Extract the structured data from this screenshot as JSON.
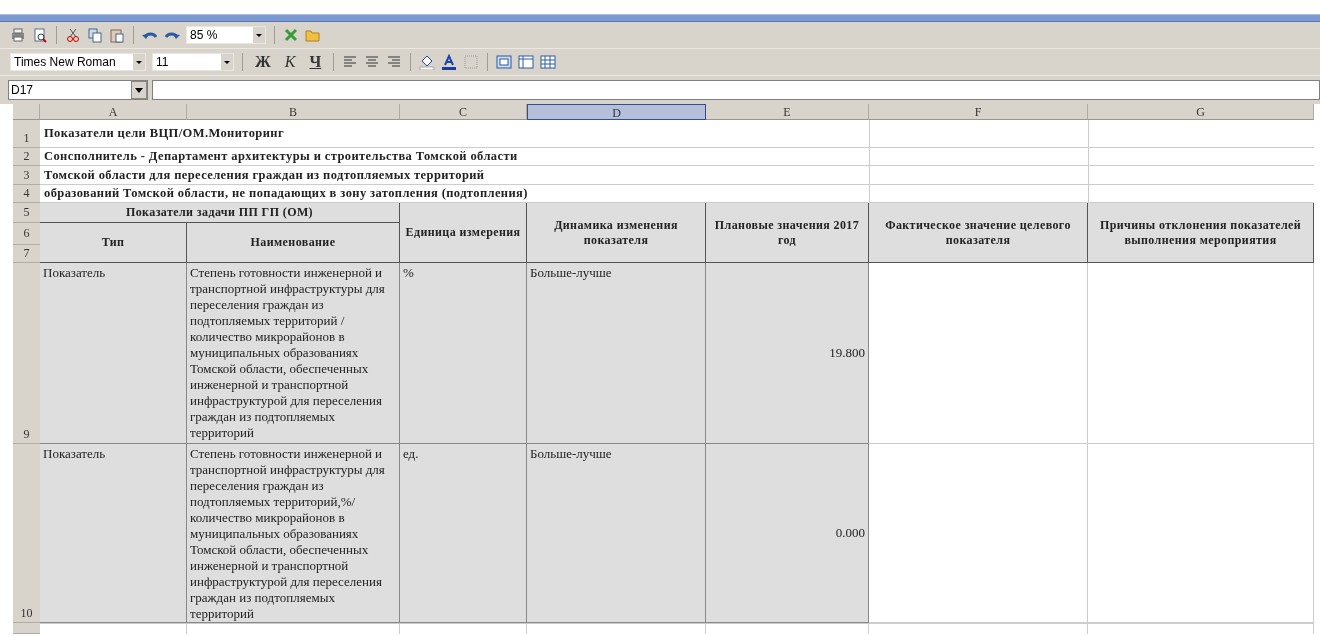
{
  "toolbar": {
    "zoom": "85 %",
    "font": "Times New Roman",
    "font_size": "11",
    "bold": "Ж",
    "italic": "К",
    "underline": "Ч"
  },
  "formula_bar": {
    "cell_ref": "D17"
  },
  "sheet": {
    "columns": [
      {
        "label": "A",
        "selected": false
      },
      {
        "label": "B",
        "selected": false
      },
      {
        "label": "C",
        "selected": false
      },
      {
        "label": "D",
        "selected": true
      },
      {
        "label": "E",
        "selected": false
      },
      {
        "label": "F",
        "selected": false
      },
      {
        "label": "G",
        "selected": false
      }
    ],
    "row_numbers": [
      "1",
      "2",
      "3",
      "4",
      "5",
      "6",
      "7",
      "9",
      "10"
    ],
    "title_rows": [
      "Показатели цели ВЦП/ОМ.Мониторинг",
      "Сонсполнитель - Департамент архитектуры и строительства Томской области",
      "Томской области для переселения граждан из подтопляемых территорий",
      "образований Томской области, не попадающих в зону затопления (подтопления)"
    ],
    "header": {
      "group": "Показатели задачи ПП ГП (ОМ)",
      "type": "Тип",
      "name": "Наименование",
      "unit": "Единица измерения",
      "dynamics": "Динамика изменения показателя",
      "plan": "Плановые значения 2017 год",
      "actual": "Фактическое значение целевого показателя",
      "reason": "Причины отклонения показателей выполнения мероприятия"
    },
    "rows": [
      {
        "type": "Показатель",
        "name": "Степень готовности инженерной и транспортной инфраструктуры для переселения граждан из подтопляемых территорий / количество микрорайонов в муниципальных образованиях Томской области, обеспеченных инженерной и транспортной инфраструктурой для переселения граждан из подтопляемых территорий",
        "unit": "%",
        "dynamics": "Больше-лучше",
        "plan": "19.800"
      },
      {
        "type": "Показатель",
        "name": "Степень готовности инженерной и транспортной инфраструктуры для переселения граждан из подтопляемых территорий,%/ количество микрорайонов в муниципальных образованиях Томской области, обеспеченных инженерной и транспортной инфраструктурой для переселения граждан из подтопляемых территорий",
        "unit": "ед.",
        "dynamics": "Больше-лучше",
        "plan": "0.000"
      }
    ]
  }
}
